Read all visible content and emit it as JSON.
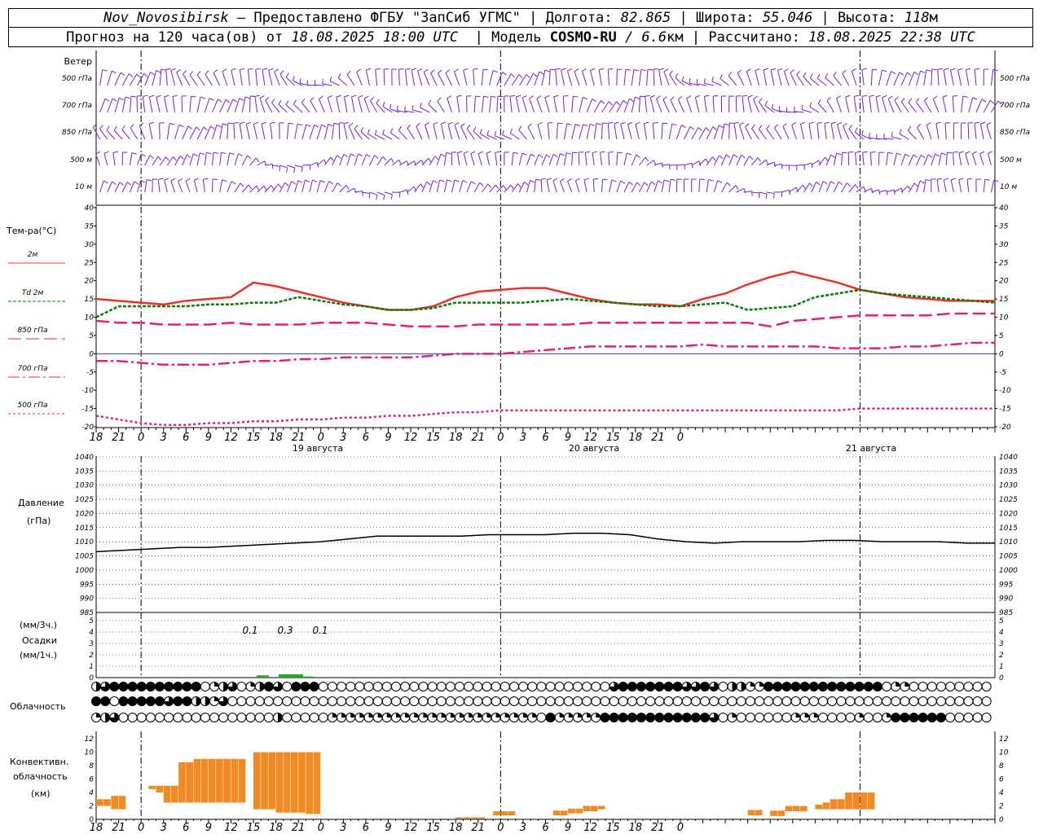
{
  "header": {
    "station": "Nov_Novosibirsk",
    "provider_text": "– Предоставлено ФГБУ \"ЗапСиб УГМС\" |",
    "lon_label": "Долгота:",
    "lon_value": "82.865",
    "lat_sep": "| Широта:",
    "lat_value": "55.046",
    "alt_sep": "| Высота:",
    "alt_value": "118",
    "alt_unit": "м",
    "forecast_prefix": "Прогноз на 120 часа(ов) от",
    "forecast_from": "18.08.2025 18:00 UTC",
    "model_label": "| Модель",
    "model_name": "COSMO-RU",
    "model_res": "/ 6.6",
    "model_res_unit": "км |",
    "calc_label": "Рассчитано:",
    "calc_time": "18.08.2025 22:38 UTC"
  },
  "hour_labels": [
    "18",
    "21",
    "0",
    "3",
    "6",
    "9",
    "12",
    "15",
    "18",
    "21",
    "0",
    "3",
    "6",
    "9",
    "12",
    "15",
    "18",
    "21",
    "0",
    "3",
    "6",
    "9",
    "12",
    "15",
    "18",
    "21",
    "0"
  ],
  "day_labels": [
    "19 августа",
    "20 августа",
    "21 августа"
  ],
  "wind_panel": {
    "title": "Ветер",
    "levels": [
      "500 гПа",
      "700 гПа",
      "850 гПа",
      "500 м",
      "10 м"
    ],
    "color": "#7a1fd6"
  },
  "temp_panel": {
    "title": "Тем-ра(°С)",
    "legend": [
      {
        "name": "2м",
        "color": "#e8322e"
      },
      {
        "name": "Td  2м",
        "color": "#0a7a0a"
      },
      {
        "name": "850 гПа",
        "color": "#e0207a"
      },
      {
        "name": "700 гПа",
        "color": "#e0207a"
      },
      {
        "name": "500 гПа",
        "color": "#e0207a"
      }
    ],
    "yticks": [
      "40",
      "35",
      "30",
      "25",
      "20",
      "15",
      "10",
      "5",
      "0",
      "-5",
      "-10",
      "-15",
      "-20"
    ]
  },
  "pressure_panel": {
    "title1": "Давление",
    "title2": "(гПа)",
    "yticks": [
      "1040",
      "1035",
      "1030",
      "1025",
      "1020",
      "1015",
      "1010",
      "1005",
      "1000",
      "995",
      "990",
      "985"
    ]
  },
  "precip_panel": {
    "title1": "(мм/3ч.)",
    "title2": "Осадки",
    "title3": "(мм/1ч.)",
    "yticks": [
      "5",
      "4",
      "3",
      "2",
      "1",
      "0"
    ],
    "values_text": [
      "0.1",
      "0.3",
      "0.1"
    ],
    "color": "#2aa52a"
  },
  "cloud_panel": {
    "title": "Облачность"
  },
  "conv_panel": {
    "title1": "Конвективн.",
    "title2": "облачность",
    "title3": "(км)",
    "yticks": [
      "12",
      "10",
      "8",
      "6",
      "4",
      "2",
      "0"
    ],
    "color": "#f08a24"
  },
  "chart_data": [
    {
      "type": "line",
      "title": "Тем-ра(°С)",
      "x": [
        0,
        3,
        6,
        9,
        12,
        15,
        18,
        21,
        24,
        27,
        30,
        33,
        36,
        39,
        42,
        45,
        48,
        51,
        54,
        57,
        60,
        63,
        66,
        69,
        72,
        75,
        78,
        81,
        84,
        87,
        90,
        93,
        96,
        99,
        102,
        105,
        108,
        111,
        114,
        117,
        120
      ],
      "ylim": [
        -20,
        40
      ],
      "series": [
        {
          "name": "2м",
          "values": [
            15,
            14.5,
            14,
            13.5,
            14.5,
            15,
            15.5,
            19.5,
            18.5,
            17,
            15.5,
            14,
            13,
            12,
            12,
            13,
            15.5,
            17,
            17.5,
            18,
            18,
            16.5,
            15,
            14,
            13.5,
            13.5,
            13,
            15,
            16.5,
            19,
            21,
            22.5,
            21,
            19.5,
            17.5,
            16.5,
            15.5,
            15,
            14.5,
            14.5,
            14.5
          ]
        },
        {
          "name": "Td  2м",
          "values": [
            10,
            13,
            13,
            13,
            13,
            13.5,
            13.5,
            14,
            14,
            15.5,
            14.5,
            13.5,
            13,
            12,
            12,
            12.5,
            14,
            14,
            14,
            14,
            14.5,
            15,
            14.5,
            14,
            13.5,
            13,
            13,
            13.5,
            14,
            12,
            12.5,
            13,
            15.5,
            16.5,
            17.5,
            16.5,
            16,
            15.5,
            15,
            14.5,
            14
          ]
        },
        {
          "name": "850 гПа",
          "values": [
            9,
            8.5,
            8.5,
            8,
            8,
            8,
            8.5,
            8,
            8,
            8,
            8.5,
            8.5,
            8.5,
            8,
            7.5,
            7.5,
            7.5,
            8,
            8,
            8,
            8,
            8,
            8.5,
            8.5,
            8.5,
            8.5,
            8.5,
            8.5,
            8.5,
            8.5,
            7.5,
            9,
            9.5,
            10,
            10.5,
            10.5,
            10.5,
            10.5,
            11,
            11,
            11
          ]
        },
        {
          "name": "700 гПа",
          "values": [
            -2,
            -2,
            -2.5,
            -3,
            -3,
            -3,
            -2.5,
            -2,
            -2,
            -1.5,
            -1.5,
            -1,
            -1,
            -1,
            -1,
            -0.5,
            0,
            0,
            0,
            0.5,
            1,
            1.5,
            2,
            2,
            2,
            2,
            2,
            2.5,
            2,
            2,
            2,
            2,
            2,
            1.5,
            1.5,
            1.5,
            2,
            2,
            2.5,
            3,
            3
          ]
        },
        {
          "name": "500 гПа",
          "values": [
            -17,
            -18,
            -19,
            -19.5,
            -19.5,
            -19,
            -19,
            -18.5,
            -18.5,
            -18,
            -18,
            -17.5,
            -17.5,
            -17,
            -17,
            -16.5,
            -16,
            -16,
            -15.5,
            -15.5,
            -15.5,
            -15.5,
            -15.5,
            -15.5,
            -15.5,
            -15.5,
            -15.5,
            -15.5,
            -15.5,
            -15.5,
            -15.5,
            -15.5,
            -15.5,
            -15.5,
            -15,
            -15,
            -15,
            -15,
            -15,
            -15,
            -15
          ]
        }
      ]
    },
    {
      "type": "line",
      "title": "Давление",
      "x": [
        0,
        6,
        12,
        18,
        24,
        30,
        36,
        42,
        48,
        54,
        60,
        66,
        72,
        78,
        84,
        90,
        96,
        102,
        108,
        114,
        120
      ],
      "ylim": [
        985,
        1040
      ],
      "series": [
        {
          "name": "",
          "values": [
            1006.5,
            1007,
            1007.5,
            1008,
            1008,
            1008.5,
            1009,
            1009.5,
            1010,
            1011,
            1012,
            1012,
            1012,
            1012,
            1012.5,
            1012.5,
            1012.5,
            1013,
            1013,
            1012.5,
            1011,
            1010,
            1009.5,
            1010,
            1010,
            1010,
            1010.5,
            1010.5,
            1010,
            1010,
            1010,
            1009.5,
            1009.5
          ]
        }
      ]
    },
    {
      "type": "bar",
      "title": "Осадки",
      "x": [
        11,
        15,
        17,
        19,
        22
      ],
      "ylim": [
        0,
        5
      ],
      "series": [
        {
          "name": "",
          "values": [
            0.1,
            0.3,
            0.2,
            0.1,
            0.05
          ]
        }
      ]
    },
    {
      "type": "bar",
      "title": "Конвективн. облачность",
      "categories_hours": [
        0,
        1,
        2,
        3,
        4,
        5,
        6,
        7,
        8,
        9,
        10,
        11,
        12,
        13,
        14,
        15,
        16,
        17,
        18,
        19,
        20,
        21,
        22,
        23,
        24,
        25,
        26,
        27,
        28,
        29,
        30,
        31,
        32,
        33,
        34,
        35,
        36,
        37,
        38,
        39,
        40,
        41,
        42,
        43,
        44,
        45,
        46,
        47,
        48,
        49,
        50,
        51,
        52,
        53,
        54,
        55,
        56,
        57,
        58,
        59,
        60,
        61,
        62,
        63,
        64,
        65,
        66,
        67,
        68,
        69,
        70,
        71,
        72,
        73,
        74,
        75,
        76,
        77,
        78,
        79,
        80,
        81,
        82,
        83,
        84,
        85,
        86,
        87,
        88,
        89,
        90,
        91,
        92,
        93,
        94,
        95,
        96,
        97,
        98,
        99,
        100,
        101,
        102,
        103,
        104,
        105,
        106,
        107,
        108,
        109,
        110,
        111,
        112,
        113,
        114,
        115,
        116,
        117,
        118,
        119
      ],
      "ylim": [
        0,
        13
      ],
      "series": [
        {
          "name": "base",
          "values": [
            2,
            2,
            1.5,
            1.5,
            0,
            0,
            0,
            4.5,
            4,
            2.5,
            2.5,
            2.5,
            2.5,
            2.5,
            2.5,
            2.5,
            2.5,
            2.5,
            2.5,
            2.5,
            0,
            1.5,
            1.5,
            1.5,
            1,
            1,
            1,
            1,
            0.8,
            0.8,
            0,
            0,
            0,
            0,
            0,
            0,
            0,
            0,
            0,
            0,
            0,
            0,
            0,
            0,
            0,
            0,
            0,
            0,
            0.1,
            0.1,
            0.1,
            0.1,
            0,
            0.6,
            0.6,
            0.6,
            0,
            0,
            0,
            0,
            0,
            0.6,
            0.6,
            0.9,
            0.9,
            1.2,
            1.2,
            1.5,
            0,
            0,
            0,
            0,
            0,
            0,
            0,
            0,
            0,
            0,
            0,
            0,
            0,
            0,
            0,
            0,
            0,
            0,
            0,
            0.6,
            0.6,
            0,
            0.5,
            0.5,
            1.2,
            1.2,
            1.2,
            0,
            1.5,
            1.5,
            1.5,
            1.5,
            1.5,
            1.5,
            1.5,
            1.5,
            0,
            0,
            0,
            0,
            0,
            0,
            0,
            0,
            0,
            0,
            0,
            0,
            0,
            0,
            0,
            0,
            0,
            0
          ]
        },
        {
          "name": "top",
          "values": [
            3,
            3,
            3.5,
            3.5,
            0,
            0,
            0,
            5,
            5,
            5,
            5,
            8.5,
            8.5,
            9,
            9,
            9,
            9,
            9,
            9,
            9,
            0,
            10,
            10,
            10,
            10,
            10,
            10,
            10,
            10,
            10,
            0,
            0,
            0,
            0,
            0,
            0,
            0,
            0,
            0,
            0,
            0,
            0,
            0,
            0,
            0,
            0,
            0,
            0,
            0.3,
            0.3,
            0.3,
            0.3,
            0,
            1.2,
            1.2,
            1.2,
            0,
            0,
            0,
            0,
            0,
            1.3,
            1.3,
            1.6,
            1.6,
            2,
            2,
            2,
            0,
            0,
            0,
            0,
            0,
            0,
            0,
            0,
            0,
            0,
            0,
            0,
            0,
            0,
            0,
            0,
            0,
            0,
            0,
            1.4,
            1.4,
            0,
            1.3,
            1.3,
            2,
            2,
            2,
            0,
            2.2,
            2.5,
            3,
            3,
            4,
            4,
            4,
            4,
            0,
            0,
            0,
            0,
            0,
            0,
            0,
            0,
            0,
            0,
            0,
            0,
            0,
            0,
            0,
            0,
            0,
            0
          ]
        }
      ]
    }
  ]
}
